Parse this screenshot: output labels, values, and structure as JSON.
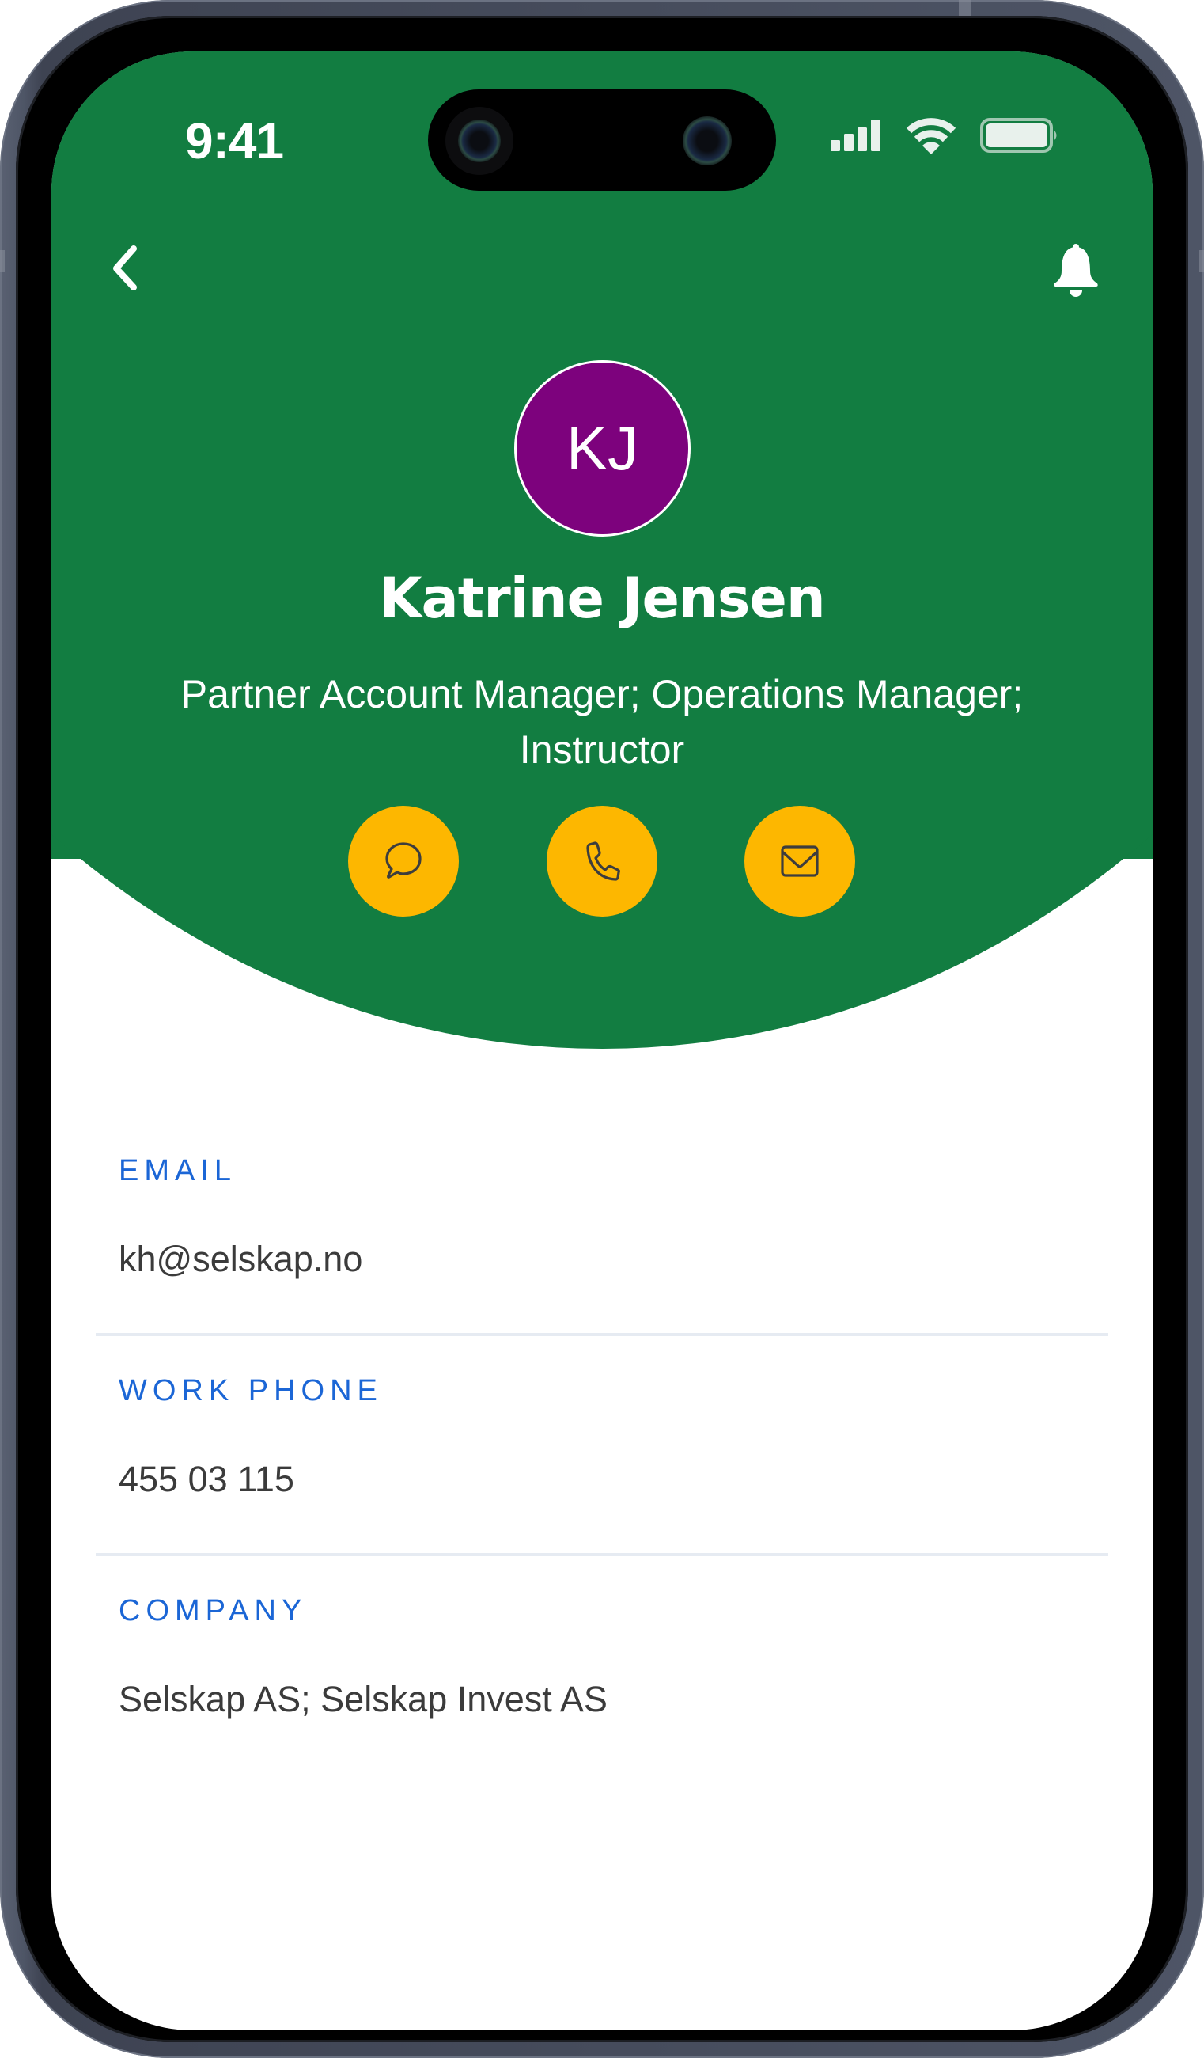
{
  "status_bar": {
    "time": "9:41",
    "icons": [
      "cellular-signal-icon",
      "wifi-icon",
      "battery-icon"
    ]
  },
  "nav": {
    "back_icon": "chevron-left-icon",
    "notifications_icon": "bell-icon"
  },
  "profile": {
    "initials": "KJ",
    "avatar_color": "#7d027d",
    "name": "Katrine Jensen",
    "roles_line1": "Partner Account Manager; Operations Manager;",
    "roles_line2": "Instructor"
  },
  "actions": [
    {
      "name": "message",
      "icon": "chat-bubble-icon"
    },
    {
      "name": "call",
      "icon": "phone-icon"
    },
    {
      "name": "email",
      "icon": "envelope-icon"
    }
  ],
  "fields": [
    {
      "label": "EMAIL",
      "value": "kh@selskap.no"
    },
    {
      "label": "WORK PHONE",
      "value": "455 03 115"
    },
    {
      "label": "COMPANY",
      "value": "Selskap AS; Selskap Invest AS"
    }
  ],
  "colors": {
    "header_green": "#127d41",
    "action_yellow": "#fdb700",
    "label_blue": "#1b66d6",
    "divider": "#e6ebf2",
    "value_text": "#3b3b3b"
  }
}
